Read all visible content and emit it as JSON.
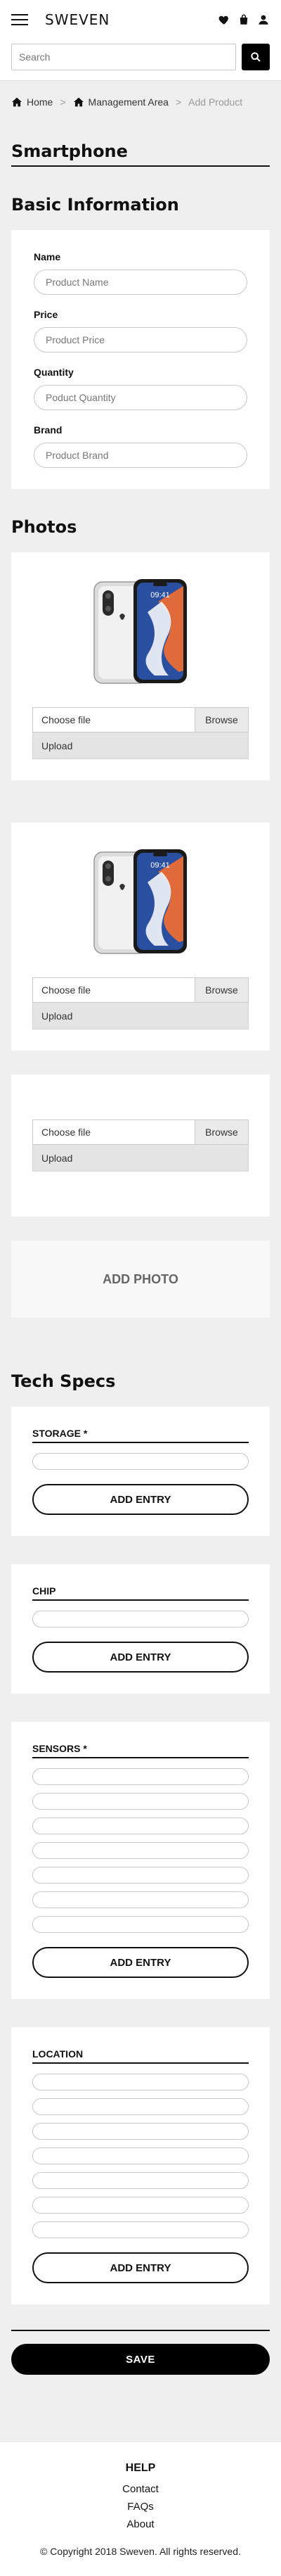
{
  "header": {
    "brand": "SWEVEN",
    "search_placeholder": "Search"
  },
  "breadcrumb": {
    "home": "Home",
    "management": "Management Area",
    "current": "Add Product",
    "separator": ">"
  },
  "page_title": "Smartphone",
  "basic": {
    "title": "Basic Information",
    "fields": [
      {
        "label": "Name",
        "placeholder": "Product Name"
      },
      {
        "label": "Price",
        "placeholder": "Product Price"
      },
      {
        "label": "Quantity",
        "placeholder": "Poduct Quantity"
      },
      {
        "label": "Brand",
        "placeholder": "Product Brand"
      }
    ]
  },
  "photos": {
    "title": "Photos",
    "choose_label": "Choose file",
    "browse_label": "Browse",
    "upload_label": "Upload",
    "phone_time": "09:41",
    "add_photo": "ADD PHOTO"
  },
  "tech": {
    "title": "Tech Specs",
    "add_entry": "ADD ENTRY",
    "specs": [
      {
        "name": "STORAGE *",
        "fields": 1
      },
      {
        "name": "CHIP",
        "fields": 1
      },
      {
        "name": "SENSORS *",
        "fields": 7
      },
      {
        "name": "LOCATION",
        "fields": 7
      }
    ]
  },
  "save_label": "SAVE",
  "footer": {
    "help": "HELP",
    "links": [
      "Contact",
      "FAQs",
      "About"
    ],
    "copyright": "© Copyright 2018 Sweven. All rights reserved."
  },
  "colors": {
    "accent": "#000000",
    "background": "#efefef",
    "card": "#ffffff"
  }
}
